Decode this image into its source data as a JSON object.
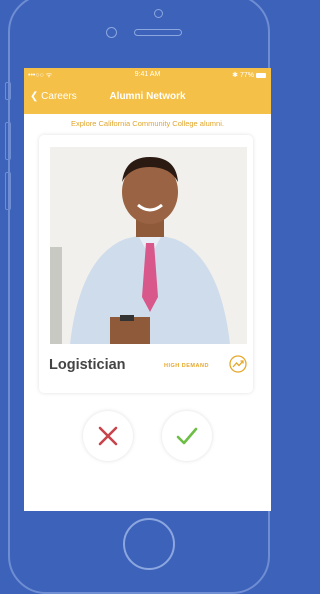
{
  "status_bar": {
    "signal": "•••○○ ᯤ",
    "time": "9:41 AM",
    "battery": "✱ 77%"
  },
  "nav": {
    "back_label": "Careers",
    "title": "Alumni Network"
  },
  "subtitle": "Explore California Community College alumni.",
  "card": {
    "job_title": "Logistician",
    "demand_label": "HIGH DEMAND",
    "trend_icon": "trend-up-icon"
  },
  "actions": {
    "reject_icon": "close-icon",
    "accept_icon": "check-icon"
  },
  "colors": {
    "accent": "#f5c047",
    "background": "#3d62b9",
    "reject": "#c8434b",
    "accept": "#6cbe45"
  }
}
